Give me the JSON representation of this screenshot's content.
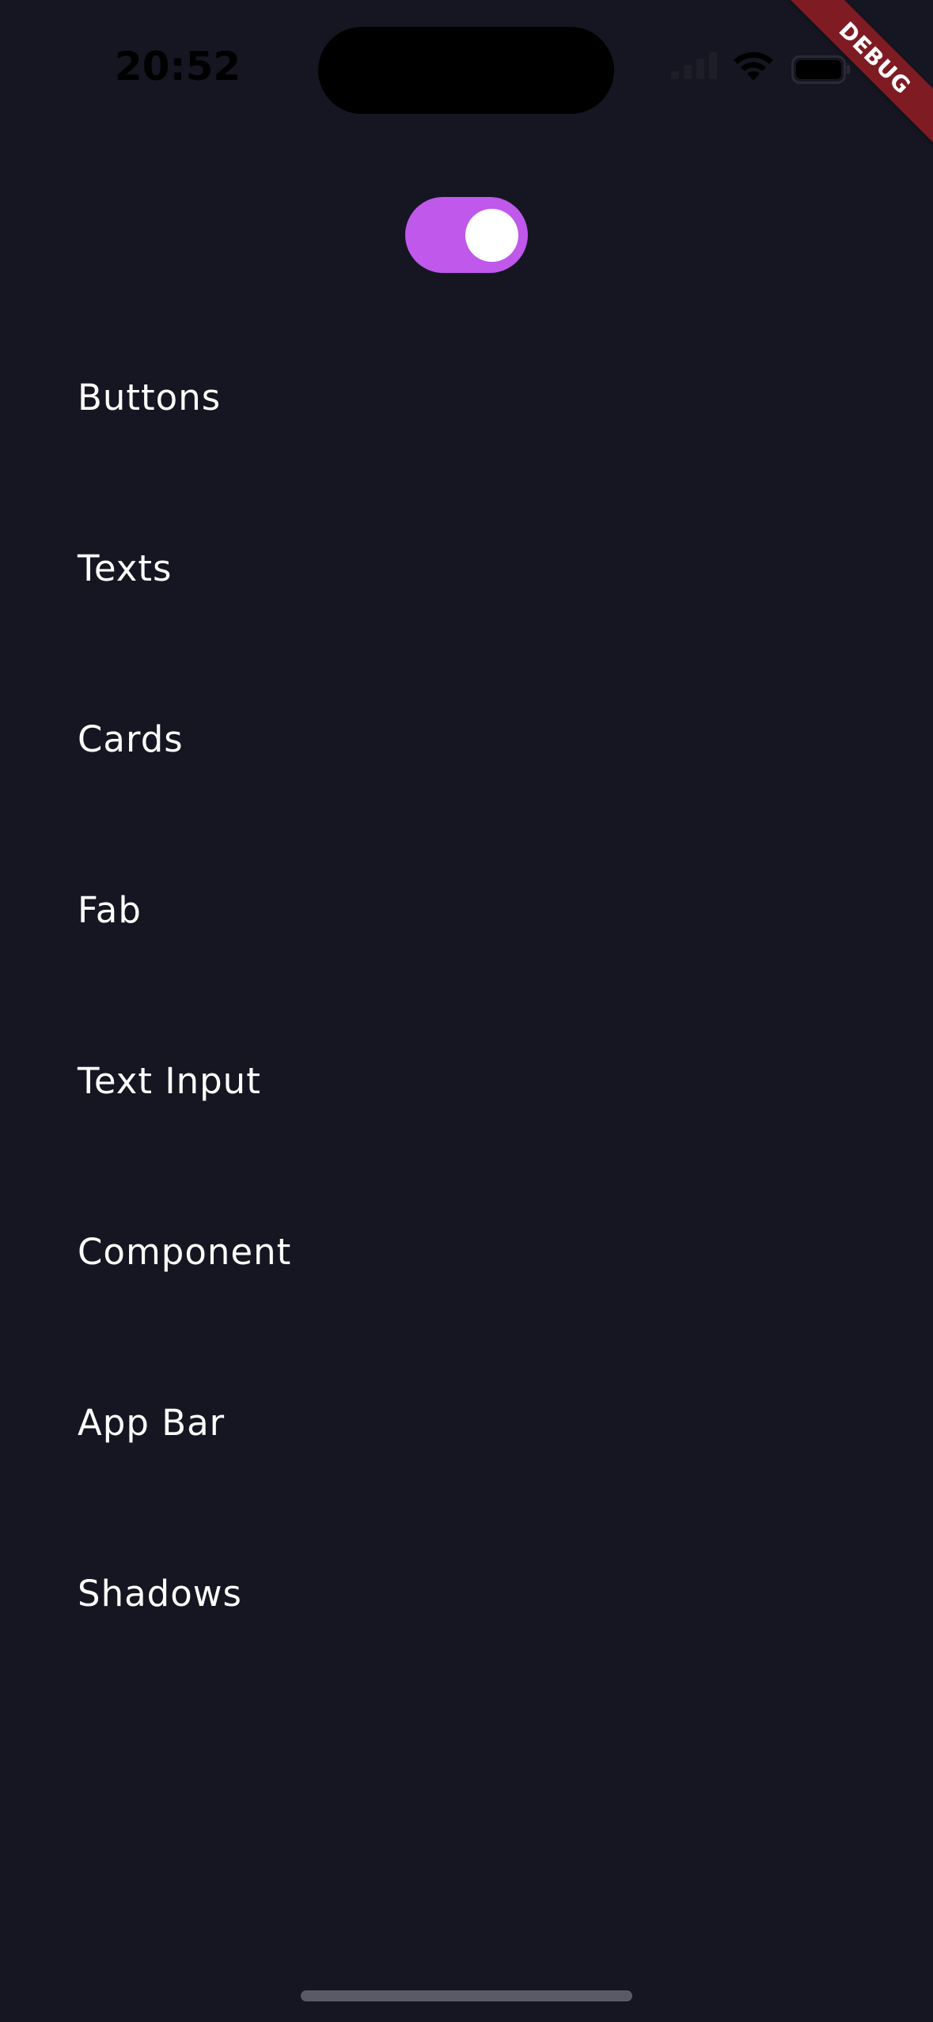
{
  "status_bar": {
    "time": "20:52",
    "icons": [
      "signal-icon",
      "wifi-icon",
      "battery-icon"
    ]
  },
  "debug_banner": {
    "label": "DEBUG",
    "color": "#7f1b23"
  },
  "theme_switch": {
    "state": "on",
    "color": "#bf58eb"
  },
  "menu": {
    "items": [
      {
        "label": "Buttons"
      },
      {
        "label": "Texts"
      },
      {
        "label": "Cards"
      },
      {
        "label": "Fab"
      },
      {
        "label": "Text Input"
      },
      {
        "label": "Component"
      },
      {
        "label": "App Bar"
      },
      {
        "label": "Shadows"
      }
    ]
  },
  "colors": {
    "background": "#161622",
    "text": "#ffffff"
  }
}
